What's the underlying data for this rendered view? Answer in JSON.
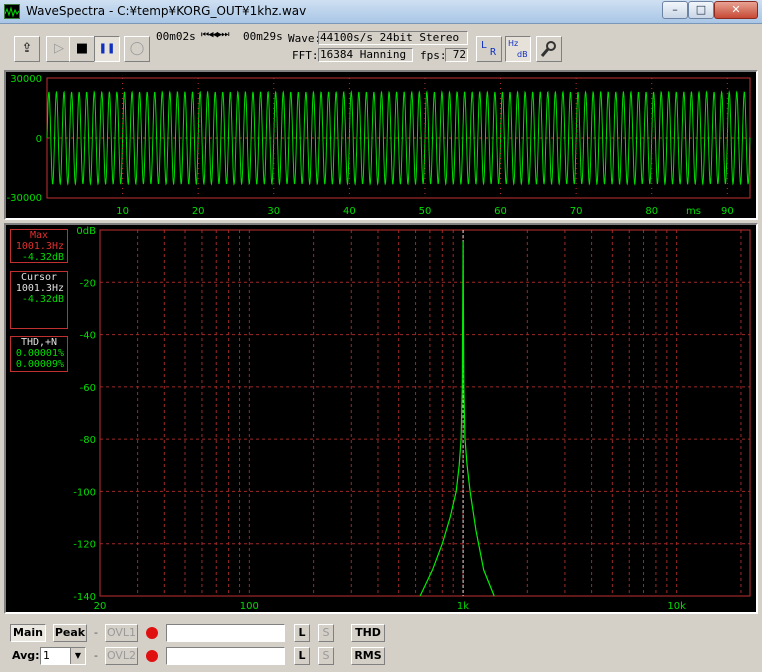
{
  "window": {
    "title": "WaveSpectra - C:¥temp¥KORG_OUT¥1khz.wav",
    "min_glyph": "–",
    "max_glyph": "□",
    "close_glyph": "✕"
  },
  "toolbar": {
    "open_glyph": "⇪",
    "play_glyph": "▷",
    "stop_glyph": "■",
    "pause_glyph": "❚❚",
    "record_glyph": "◯",
    "time_current": "00m02s",
    "nav_glyphs": "⏮◀◀▶⏭",
    "time_total": "00m29s",
    "wave_label": "Wave:",
    "wave_value": "44100s/s 24bit Stereo",
    "fft_label": "FFT:",
    "fft_value": "16384 Hanning",
    "fps_label": "fps:",
    "fps_value": "72",
    "lr_label_l": "L",
    "lr_label_r": "R",
    "hzdb_label_hz": "Hz",
    "hzdb_label_db": "dB",
    "settings_glyph": "🔧",
    "seek_position": 0.07
  },
  "wave_plot": {
    "y_ticks": [
      "30000",
      "0",
      "-30000"
    ],
    "x_ticks": [
      "10",
      "20",
      "30",
      "40",
      "50",
      "60",
      "70",
      "80",
      "90"
    ],
    "x_unit": "ms",
    "trace_color": "#00dd00",
    "grid_color": "#c03030"
  },
  "spectrum": {
    "max_box": {
      "header": "Max",
      "freq": "1001.3Hz",
      "level": "-4.32dB"
    },
    "cursor_box": {
      "header": "Cursor",
      "freq": "1001.3Hz",
      "level": "-4.32dB"
    },
    "thd_box": {
      "header": "THD,+N",
      "thd": "0.00001%",
      "thdn": "0.00009%"
    },
    "y_ticks": [
      "0dB",
      "-20",
      "-40",
      "-60",
      "-80",
      "-100",
      "-120",
      "-140"
    ],
    "x_ticks": [
      "20",
      "100",
      "1k",
      "10k"
    ],
    "trace_color": "#00ee00",
    "peak_color": "#dddddd"
  },
  "chart_data": {
    "type": "line",
    "title": "",
    "xlabel": "",
    "ylabel": "",
    "x_scale": "log",
    "xlim": [
      20,
      22050
    ],
    "ylim": [
      -140,
      0
    ],
    "peak": {
      "freq_hz": 1001.3,
      "level_db": -4.32
    },
    "series": [
      {
        "x": [
          630,
          720,
          800,
          870,
          930,
          960,
          980,
          993,
          1001.3,
          1009,
          1022,
          1045,
          1080,
          1150,
          1250,
          1400
        ],
        "values": [
          -140,
          -130,
          -120,
          -110,
          -100,
          -90,
          -80,
          -60,
          -4.32,
          -60,
          -80,
          -90,
          -100,
          -115,
          -130,
          -140
        ]
      }
    ]
  },
  "bottom": {
    "main_label": "Main",
    "peak_label": "Peak",
    "ovl1_label": "OVL1",
    "ovl2_label": "OVL2",
    "l_label": "L",
    "s_label": "S",
    "thd_label": "THD",
    "rms_label": "RMS",
    "avg_label": "Avg:",
    "avg_value": "1",
    "dash": "-"
  }
}
